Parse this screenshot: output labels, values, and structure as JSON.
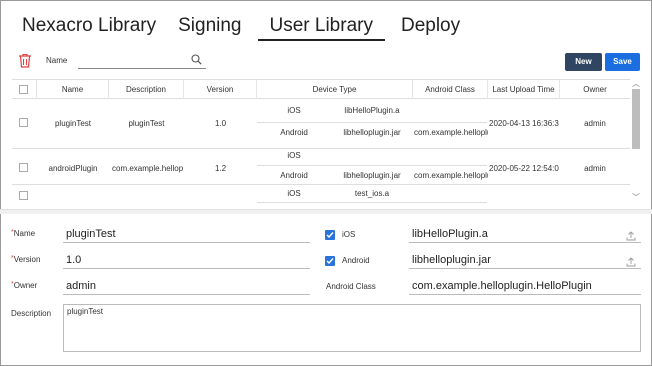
{
  "tabs": [
    "Nexacro Library",
    "Signing",
    "User Library",
    "Deploy"
  ],
  "toolbar": {
    "name_label": "Name",
    "search_value": "",
    "new_label": "New",
    "save_label": "Save"
  },
  "grid": {
    "columns": [
      "Name",
      "Description",
      "Version",
      "Device Type",
      "Android Class",
      "Last Upload Time",
      "Owner"
    ],
    "rows": [
      {
        "name": "pluginTest",
        "description": "pluginTest",
        "version": "1.0",
        "ios_label": "iOS",
        "ios_file": "libHelloPlugin.a",
        "android_label": "Android",
        "android_file": "libhelloplugin.jar",
        "android_class": "com.example.helloplug",
        "upload_time": "2020-04-13 16:36:3",
        "owner": "admin"
      },
      {
        "name": "androidPlugin",
        "description": "com.example.hellop",
        "version": "1.2",
        "ios_label": "iOS",
        "ios_file": "",
        "android_label": "Android",
        "android_file": "libhelloplugin.jar",
        "android_class": "com.example.helloplug",
        "upload_time": "2020-05-22 12:54:0",
        "owner": "admin"
      },
      {
        "name": "",
        "description": "",
        "version": "",
        "ios_label": "iOS",
        "ios_file": "test_ios.a"
      }
    ]
  },
  "form": {
    "name_label": "Name",
    "name_value": "pluginTest",
    "version_label": "Version",
    "version_value": "1.0",
    "owner_label": "Owner",
    "owner_value": "admin",
    "description_label": "Description",
    "description_value": "pluginTest",
    "ios_label": "iOS",
    "ios_file": "libHelloPlugin.a",
    "android_label": "Android",
    "android_file": "libhelloplugin.jar",
    "android_class_label": "Android Class",
    "android_class_value": "com.example.helloplugin.HelloPlugin",
    "required_mark": "*"
  },
  "icons": {
    "trash": "trash-icon",
    "search": "search-icon",
    "upload": "upload-icon"
  },
  "colors": {
    "new_button": "#2f4561",
    "save_button": "#1a6ee0",
    "trash": "#e04040",
    "checkbox": "#2a73d8"
  }
}
